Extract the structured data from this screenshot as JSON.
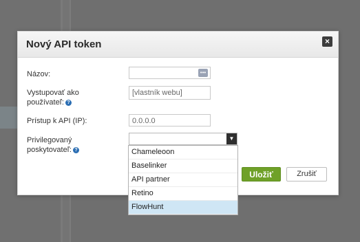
{
  "dialog": {
    "title": "Nový API token",
    "close_symbol": "×"
  },
  "form": {
    "name_label": "Názov:",
    "name_value": "",
    "owner_label_line1": "Vystupovať ako",
    "owner_label_line2": "používateľ:",
    "owner_placeholder": "[vlastník webu]",
    "ip_label": "Prístup k API (IP):",
    "ip_value": "0.0.0.0",
    "provider_label_line1": "Privilegovaný",
    "provider_label_line2": "poskytovateľ:",
    "provider_value": "",
    "help_symbol": "?"
  },
  "dropdown": {
    "options": [
      {
        "label": "Chameleoon"
      },
      {
        "label": "Baselinker"
      },
      {
        "label": "API partner"
      },
      {
        "label": "Retino"
      },
      {
        "label": "FlowHunt",
        "selected": true
      }
    ]
  },
  "buttons": {
    "save_label": "Uložiť",
    "cancel_label": "Zrušiť"
  },
  "colors": {
    "save_button": "#6fa128",
    "help_icon": "#2b6eb3",
    "selected_option": "#cfe6f5"
  }
}
